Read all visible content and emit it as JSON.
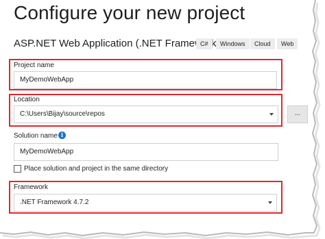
{
  "header": {
    "title": "Configure your new project",
    "template_name": "ASP.NET Web Application (.NET Framework)",
    "tags": [
      "C#",
      "Windows",
      "Cloud",
      "Web"
    ]
  },
  "project_name": {
    "label": "Project name",
    "value": "MyDemoWebApp"
  },
  "location": {
    "label": "Location",
    "value": "C:\\Users\\Bijay\\source\\repos",
    "browse_label": "..."
  },
  "solution_name": {
    "label": "Solution name",
    "value": "MyDemoWebApp",
    "info_glyph": "i"
  },
  "same_directory": {
    "label": "Place solution and project in the same directory",
    "checked": false
  },
  "framework": {
    "label": "Framework",
    "value": ".NET Framework 4.7.2"
  },
  "colors": {
    "highlight": "#e0262f",
    "info_icon": "#1b73c9",
    "tag_bg": "#ececec"
  }
}
